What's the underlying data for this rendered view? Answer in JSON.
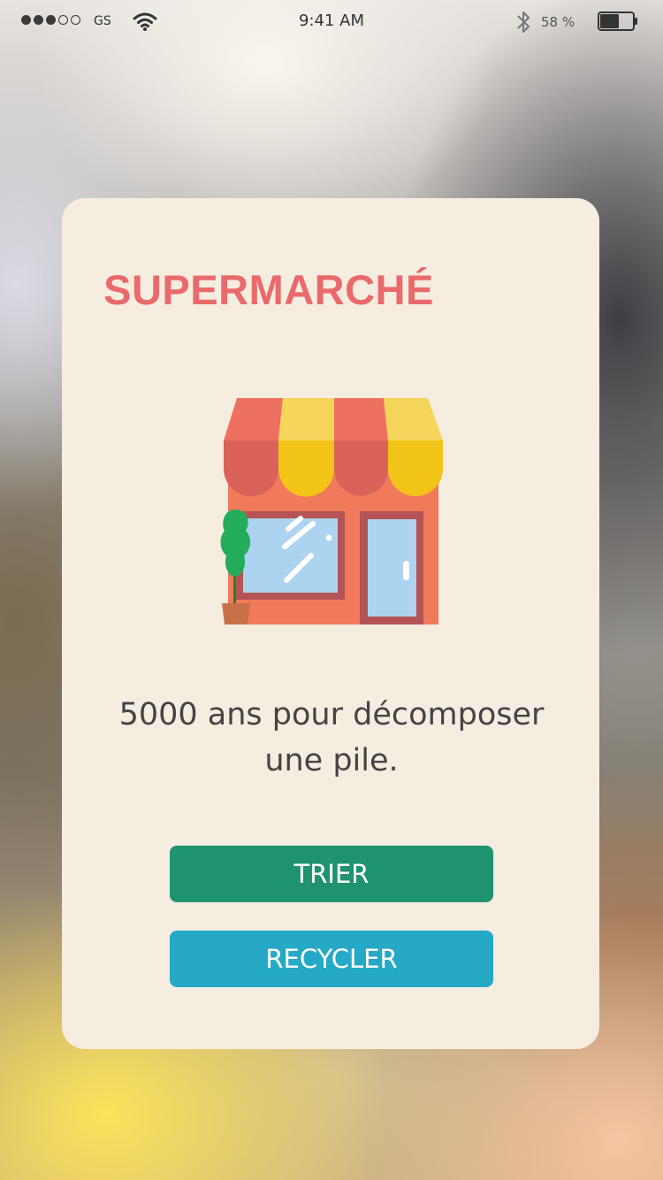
{
  "status_bar": {
    "carrier": "GS",
    "time": "9:41 AM",
    "battery_percent": "58 %",
    "battery_level": 0.58,
    "signal_bars_filled": 3,
    "signal_bars_total": 5
  },
  "card": {
    "title": "SUPERMARCHÉ",
    "illustration": "shop-storefront-icon",
    "message": "5000 ans pour décomposer une pile.",
    "buttons": {
      "trier": "TRIER",
      "recycler": "RECYCLER"
    }
  },
  "colors": {
    "title": "#ea6a6c",
    "card_background": "#f5ede0",
    "trier_button": "#1f9370",
    "recycler_button": "#25a9c6"
  }
}
